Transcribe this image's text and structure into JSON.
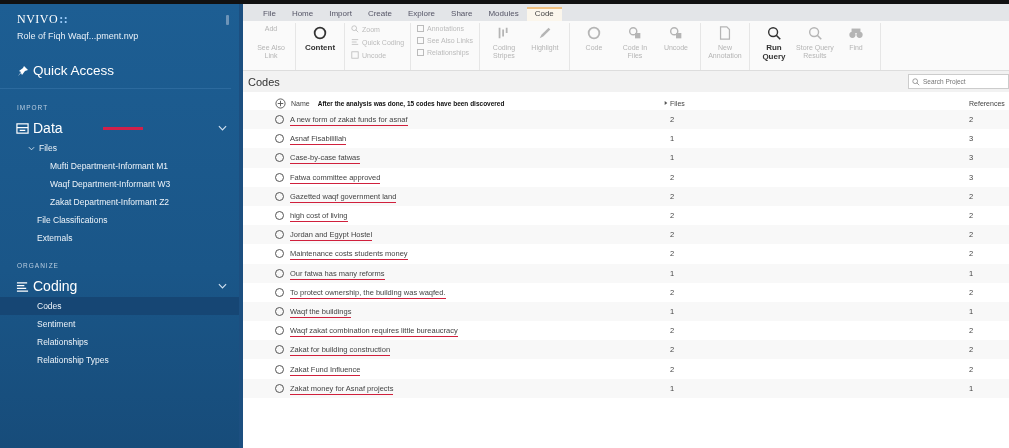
{
  "app": {
    "logo": "NVIVO",
    "logo_mark": "::",
    "project": "Role of Fiqh Waqf...pment.nvp"
  },
  "sidebar": {
    "quick_access": "Quick Access",
    "sections": [
      {
        "heading": "IMPORT",
        "group": "Data",
        "expanded": true,
        "marked": true,
        "items": [
          {
            "label": "Files",
            "selected": false,
            "expanded": true,
            "children": [
              {
                "label": "Mufti Department-Informant M1",
                "selected": false
              },
              {
                "label": "Waqf Department-Informant W3",
                "selected": false
              },
              {
                "label": "Zakat Department-Informant Z2",
                "selected": false
              }
            ]
          },
          {
            "label": "File Classifications",
            "selected": false
          },
          {
            "label": "Externals",
            "selected": false
          }
        ]
      },
      {
        "heading": "ORGANIZE",
        "group": "Coding",
        "expanded": true,
        "marked": false,
        "items": [
          {
            "label": "Codes",
            "selected": true
          },
          {
            "label": "Sentiment",
            "selected": false
          },
          {
            "label": "Relationships",
            "selected": false
          },
          {
            "label": "Relationship Types",
            "selected": false
          }
        ]
      }
    ]
  },
  "ribbon": {
    "tabs": [
      {
        "label": "File",
        "selected": false
      },
      {
        "label": "Home",
        "selected": false
      },
      {
        "label": "Import",
        "selected": false
      },
      {
        "label": "Create",
        "selected": false
      },
      {
        "label": "Explore",
        "selected": false
      },
      {
        "label": "Share",
        "selected": false
      },
      {
        "label": "Modules",
        "selected": false
      },
      {
        "label": "Code",
        "selected": true
      }
    ],
    "groups": [
      {
        "kind": "large",
        "items": [
          {
            "label": "See Also Link",
            "caption": "Add",
            "disabled": true
          }
        ]
      },
      {
        "kind": "large",
        "items": [
          {
            "label": "Content",
            "disabled": false
          }
        ]
      },
      {
        "kind": "small",
        "items": [
          {
            "label": "Zoom",
            "disabled": true
          },
          {
            "label": "Quick Coding",
            "disabled": true
          },
          {
            "label": "Uncode",
            "disabled": true
          }
        ]
      },
      {
        "kind": "checks",
        "items": [
          {
            "label": "Annotations",
            "disabled": true
          },
          {
            "label": "See Also Links",
            "disabled": true
          },
          {
            "label": "Relationships",
            "disabled": true
          }
        ]
      },
      {
        "kind": "large",
        "items": [
          {
            "label": "Coding Stripes",
            "disabled": true
          },
          {
            "label": "Highlight",
            "disabled": true
          }
        ]
      },
      {
        "kind": "large",
        "items": [
          {
            "label": "Code",
            "disabled": true
          },
          {
            "label": "Code In Files",
            "disabled": true
          },
          {
            "label": "Uncode",
            "disabled": true
          }
        ]
      },
      {
        "kind": "large",
        "items": [
          {
            "label": "New Annotation",
            "disabled": true
          }
        ]
      },
      {
        "kind": "large",
        "items": [
          {
            "label": "Run Query",
            "disabled": false
          },
          {
            "label": "Store Query Results",
            "disabled": true
          },
          {
            "label": "Find",
            "disabled": true
          }
        ]
      }
    ]
  },
  "codes": {
    "title": "Codes",
    "search": {
      "placeholder": "Search Project"
    },
    "columns": {
      "name": "Name",
      "note": "After the analysis was done, 15 codes have been discovered",
      "files": "Files",
      "references": "References"
    },
    "rows": [
      {
        "name": "A new form of zakat funds for asnaf",
        "files": "2",
        "references": "2",
        "underlined": true
      },
      {
        "name": "Asnaf Fisabilillah",
        "files": "1",
        "references": "3",
        "underlined": true
      },
      {
        "name": "Case-by-case fatwas",
        "files": "1",
        "references": "3",
        "underlined": true
      },
      {
        "name": "Fatwa committee approved",
        "files": "2",
        "references": "3",
        "underlined": true
      },
      {
        "name": "Gazetted waqf government land",
        "files": "2",
        "references": "2",
        "underlined": true
      },
      {
        "name": "high cost of living",
        "files": "2",
        "references": "2",
        "underlined": true
      },
      {
        "name": "Jordan and Egypt Hostel",
        "files": "2",
        "references": "2",
        "underlined": true
      },
      {
        "name": "Maintenance costs students money",
        "files": "2",
        "references": "2",
        "underlined": true
      },
      {
        "name": "Our fatwa has many reforms",
        "files": "1",
        "references": "1",
        "underlined": true
      },
      {
        "name": "To protect ownership, the building was waqfed.",
        "files": "2",
        "references": "2",
        "underlined": true
      },
      {
        "name": "Waqf the buildings",
        "files": "1",
        "references": "1",
        "underlined": true
      },
      {
        "name": "Waqf zakat combination requires little bureaucracy",
        "files": "2",
        "references": "2",
        "underlined": true
      },
      {
        "name": "Zakat for building construction",
        "files": "2",
        "references": "2",
        "underlined": true
      },
      {
        "name": "Zakat Fund Influence",
        "files": "2",
        "references": "2",
        "underlined": true
      },
      {
        "name": "Zakat money for Asnaf projects",
        "files": "1",
        "references": "1",
        "underlined": true
      }
    ]
  }
}
